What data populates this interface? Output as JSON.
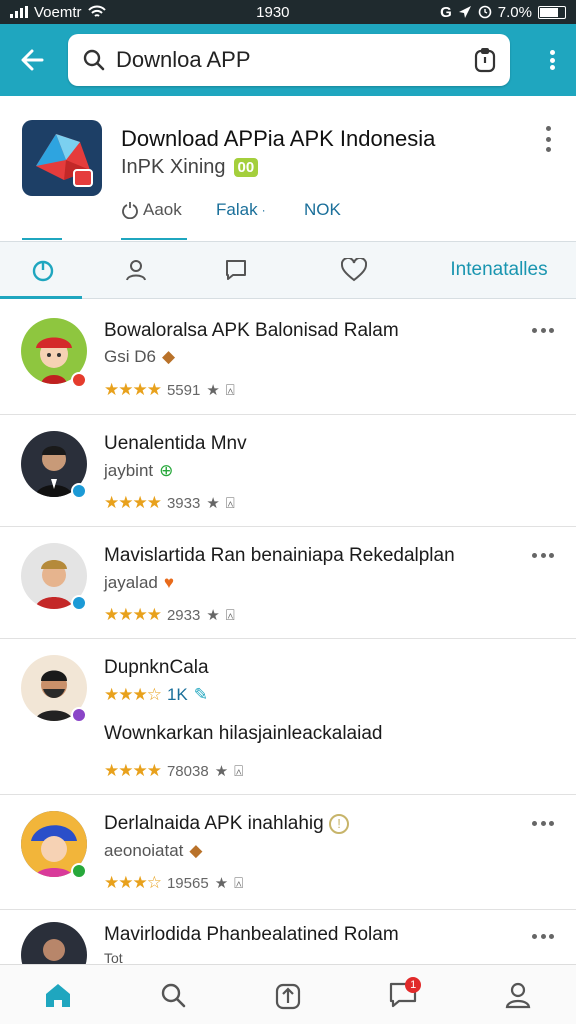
{
  "status_bar": {
    "carrier": "Voemtr",
    "time": "1930",
    "battery_text": "7.0%"
  },
  "search": {
    "value": "Downloa APP"
  },
  "app": {
    "title": "Download APPia APK Indonesia",
    "subtitle": "InPK Xining",
    "badge": "00",
    "meta": [
      "Aaok",
      "Falak",
      "NOK"
    ]
  },
  "tabs": [
    {
      "icon": "clock-icon"
    },
    {
      "icon": "person-icon"
    },
    {
      "icon": "chat-icon"
    },
    {
      "icon": "heart-icon"
    },
    {
      "label": "Intenatalles"
    }
  ],
  "list": [
    {
      "title": "Bowaloralsa APK Balonisad Ralam",
      "sub": "Gsi D6",
      "rating": "5591",
      "avatar_color": "#8ec63f",
      "badge_color": "#e53c2d"
    },
    {
      "title": "Uenalentida Mnv",
      "sub": "jaybint",
      "rating": "3933",
      "avatar_color": "#2a2f3a",
      "badge_color": "#1c9ad6"
    },
    {
      "title": "Mavislartida Ran benainiapa Rekedalplan",
      "sub": "jayalad",
      "rating": "2933",
      "avatar_color": "#e4e4e4",
      "badge_color": "#1c9ad6"
    },
    {
      "title": "DupnknCala",
      "sub": "1K",
      "desc": "Wownkarkan hilasjainleackalaiad",
      "rating": "78038",
      "avatar_color": "#f2e6d6",
      "badge_color": "#8a45c7"
    },
    {
      "title": "Derlalnaida APK inahlahig",
      "sub": "aeonoiatat",
      "rating": "19565",
      "avatar_color": "#2a60c9",
      "badge_color": "#27a83b"
    },
    {
      "title": "Mavirlodida Phanbealatined Rolam",
      "sub": "Tot",
      "rating": "",
      "avatar_color": "#2a2f3a",
      "badge_color": "#1c9ad6"
    }
  ],
  "bottom_nav": {
    "notifications": "1"
  },
  "colors": {
    "accent": "#1fa6bf",
    "star": "#e8a11c"
  }
}
